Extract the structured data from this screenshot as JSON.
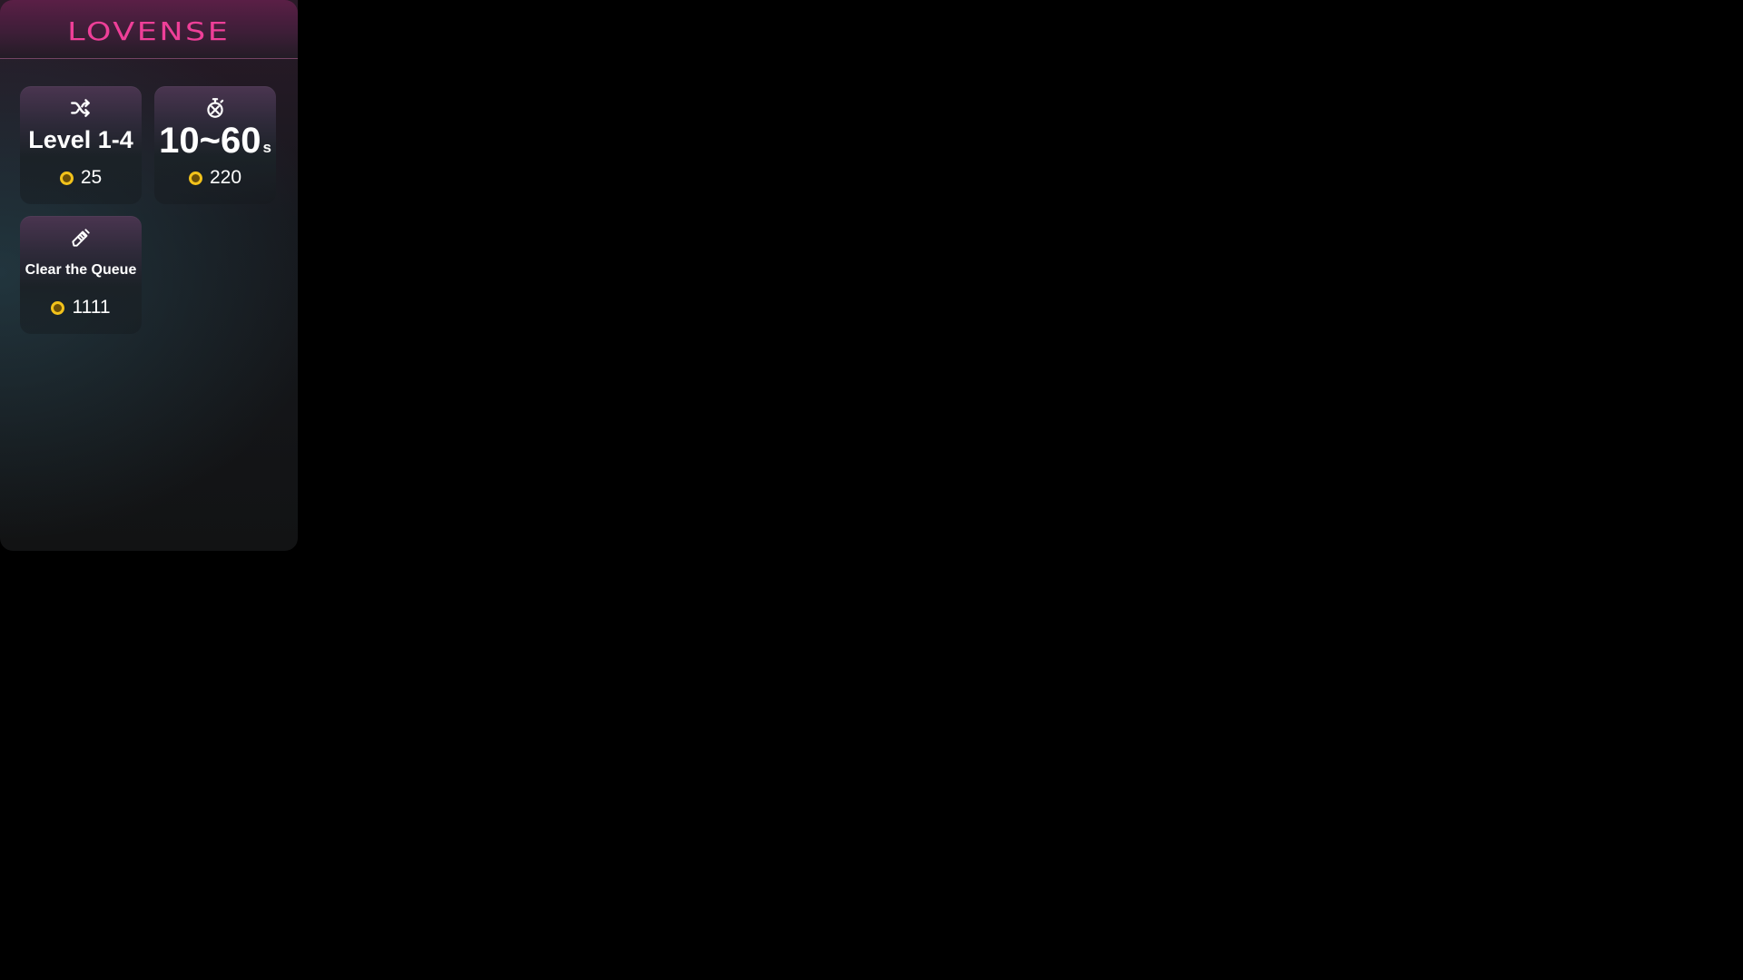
{
  "brand": {
    "logo_text": "LOVENSE",
    "color": "#ee3f98"
  },
  "cards": [
    {
      "icon": "shuffle-icon",
      "title": "Level 1-4",
      "price": "25"
    },
    {
      "icon": "stopwatch-icon",
      "title": "10~60",
      "unit": "s",
      "price": "220"
    },
    {
      "icon": "eraser-icon",
      "title": "Clear the Queue",
      "price": "1111"
    }
  ],
  "colors": {
    "coin": "#f2c21b",
    "background": "#000000"
  }
}
